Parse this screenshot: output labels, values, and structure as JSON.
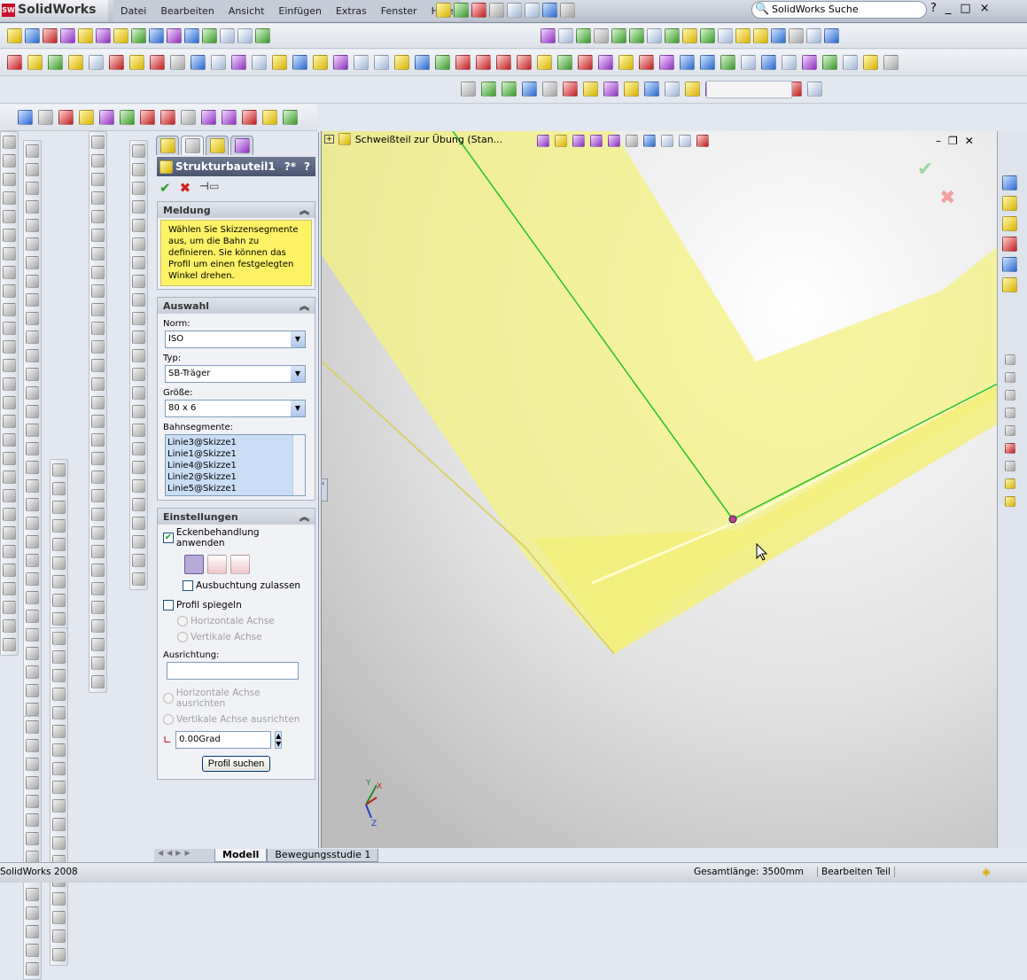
{
  "app": {
    "name": "SolidWorks",
    "search_placeholder": "SolidWorks Suche",
    "help": "?",
    "window_buttons": [
      "_",
      "□",
      "×"
    ]
  },
  "menu": [
    "Datei",
    "Bearbeiten",
    "Ansicht",
    "Einfügen",
    "Extras",
    "Fenster",
    "Hilfe"
  ],
  "toolbars": {
    "title_icons": [
      "pin-icon",
      "new-icon",
      "open-icon",
      "save-icon",
      "print-icon",
      "undo-icon",
      "select-icon",
      "options-icon"
    ],
    "row1": [
      "new-icon",
      "open-icon",
      "save-icon",
      "print-icon",
      "print-preview-icon",
      "cut-icon",
      "copy-icon",
      "undo-icon",
      "redo-icon",
      "select-icon",
      "selection-filter-icon",
      "rebuild-icon",
      "grid-icon",
      "properties-icon",
      "help-icon"
    ],
    "row1b": [
      "smart-dimension-icon",
      "zoom-fit-icon",
      "zoom-area-icon",
      "zoom-in-out-icon",
      "zoom-selection-icon",
      "rotate-icon",
      "pan-icon",
      "roll-icon",
      "view-orientation-icon",
      "wireframe-icon",
      "hidden-lines-visible-icon",
      "hidden-lines-removed-icon",
      "shaded-edges-icon",
      "shaded-icon",
      "shadows-icon",
      "realview-icon",
      "appearance-icon"
    ],
    "row2": [
      "sketch-icon",
      "smart-dim-icon",
      "relations-icon",
      "display-icon",
      "check-icon",
      "ordinate-icon",
      "trim-icon",
      "extend-icon",
      "offset-icon",
      "sum-icon",
      "mirror-icon",
      "move-icon",
      "snap-icon",
      "line-icon",
      "point-icon",
      "3d-sketch-icon",
      "record-icon",
      "filter-icon",
      "filter-edges-icon",
      "filter-faces-icon",
      "select-icon",
      "mate-icon",
      "plane-icon",
      "axis-icon",
      "coordinate-icon",
      "point-ref-icon",
      "curve-icon",
      "helix-icon",
      "spline-icon",
      "surface-icon",
      "weldment-icon",
      "structural-member-icon",
      "trim-extend-icon",
      "end-cap-icon",
      "gusset-icon",
      "fillet-bead-icon",
      "cut-list-icon",
      "sheetmetal-icon",
      "flange-icon",
      "fold-icon",
      "unfold-icon",
      "jog-icon",
      "hem-icon",
      "corner-icon"
    ],
    "row3": [
      "section-icon",
      "front-view-icon",
      "back-view-icon",
      "left-view-icon",
      "right-view-icon",
      "top-view-icon",
      "bottom-view-icon",
      "iso-view-icon",
      "normal-to-icon",
      "link-views-icon",
      "configuration-icon",
      "camera-icon",
      "photoworks-icon",
      "render-icon",
      "lights-icon",
      "layers-icon",
      "list-icon",
      "grid-settings-icon"
    ],
    "row4": [
      "point-icon",
      "circle-icon",
      "line-icon",
      "polygon-icon",
      "trim-icon",
      "extend-icon",
      "convert-icon",
      "offset-icon",
      "mirror-icon",
      "corner-icon",
      "rect-pattern-icon",
      "dimension-icon",
      "table-icon",
      "angle-icon"
    ]
  },
  "property_manager": {
    "title": "Strukturbauteil1",
    "help_icons": [
      "?*",
      "?"
    ],
    "message": {
      "header": "Meldung",
      "text": "Wählen Sie Skizzensegmente aus, um die Bahn zu definieren. Sie können das Profil um einen festgelegten Winkel drehen."
    },
    "selection": {
      "header": "Auswahl",
      "norm_label": "Norm:",
      "norm_value": "ISO",
      "type_label": "Typ:",
      "type_value": "SB-Träger",
      "size_label": "Größe:",
      "size_value": "80 x 6",
      "segments_label": "Bahnsegmente:",
      "segments": [
        "Linie3@Skizze1",
        "Linie1@Skizze1",
        "Linie4@Skizze1",
        "Linie2@Skizze1",
        "Linie5@Skizze1"
      ]
    },
    "settings": {
      "header": "Einstellungen",
      "corner_treatment": "Eckenbehandlung anwenden",
      "corner_treatment_checked": true,
      "allow_bulge": "Ausbuchtung zulassen",
      "allow_bulge_checked": false,
      "mirror_profile": "Profil spiegeln",
      "mirror_profile_checked": false,
      "horizontal_axis": "Horizontale Achse",
      "vertical_axis": "Vertikale Achse",
      "alignment_label": "Ausrichtung:",
      "alignment_value": "",
      "align_horizontal": "Horizontale Achse ausrichten",
      "align_vertical": "Vertikale Achse ausrichten",
      "angle_value": "0.00Grad",
      "locate_profile": "Profil suchen"
    }
  },
  "viewport": {
    "tree_label": "Schweißteil zur Übung  (Stan...",
    "triad": {
      "x": "X",
      "y": "Y",
      "z": "Z"
    },
    "colors": {
      "beam": "#f7f38a",
      "sketch": "#22c422"
    }
  },
  "bottom_tabs": [
    "Modell",
    "Bewegungsstudie 1"
  ],
  "status": {
    "app": "SolidWorks 2008",
    "total_length": "Gesamtlänge: 3500mm",
    "mode": "Bearbeiten Teil"
  }
}
